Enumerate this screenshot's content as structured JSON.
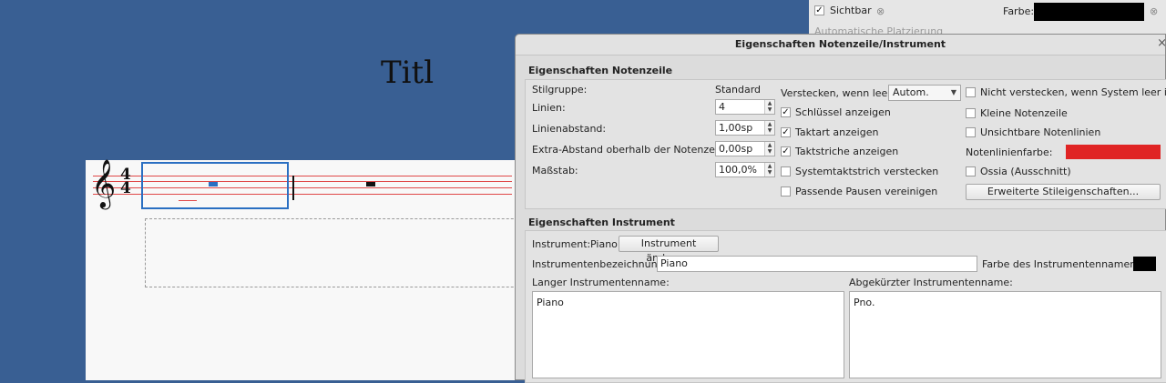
{
  "score": {
    "title_partial": "Titl"
  },
  "background_panel": {
    "visible_label": "Sichtbar",
    "visible_checked": true,
    "color_label": "Farbe:",
    "color_value": "#000000",
    "faded_label": "Automatische Platzierung"
  },
  "dialog": {
    "title": "Eigenschaften Notenzeile/Instrument",
    "staff_section": {
      "title": "Eigenschaften Notenzeile",
      "style_group_label": "Stilgruppe:",
      "style_group_value": "Standard",
      "lines_label": "Linien:",
      "lines_value": "4",
      "line_distance_label": "Linienabstand:",
      "line_distance_value": "1,00sp",
      "extra_distance_label": "Extra-Abstand oberhalb der Notenzeile:",
      "extra_distance_value": "0,00sp",
      "scale_label": "Maßstab:",
      "scale_value": "100,0%",
      "hide_when_empty_label": "Verstecken, wenn leer:",
      "hide_when_empty_value": "Autom.",
      "checkboxes_mid": [
        {
          "label": "Schlüssel anzeigen",
          "checked": true
        },
        {
          "label": "Taktart anzeigen",
          "checked": true
        },
        {
          "label": "Taktstriche anzeigen",
          "checked": true
        },
        {
          "label": "Systemtaktstrich verstecken",
          "checked": false
        },
        {
          "label": "Passende Pausen vereinigen",
          "checked": false
        }
      ],
      "checkboxes_right": [
        {
          "label": "Nicht verstecken, wenn System leer ist",
          "checked": false
        },
        {
          "label": "Kleine Notenzeile",
          "checked": false
        },
        {
          "label": "Unsichtbare Notenlinien",
          "checked": false
        },
        {
          "label": "Ossia (Ausschnitt)",
          "checked": false
        }
      ],
      "staff_line_color_label": "Notenlinienfarbe:",
      "staff_line_color": "#e02424",
      "advanced_button": "Erweiterte Stileigenschaften..."
    },
    "instrument_section": {
      "title": "Eigenschaften Instrument",
      "instrument_label": "Instrument:",
      "instrument_value": "Piano",
      "change_button": "Instrument ändern...",
      "designation_label": "Instrumentenbezeichnung:",
      "designation_value": "Piano",
      "name_color_label": "Farbe des Instrumentennamens:",
      "name_color": "#000000",
      "long_name_label": "Langer Instrumentenname:",
      "long_name_value": "Piano",
      "short_name_label": "Abgekürzter Instrumentenname:",
      "short_name_value": "Pno."
    }
  }
}
